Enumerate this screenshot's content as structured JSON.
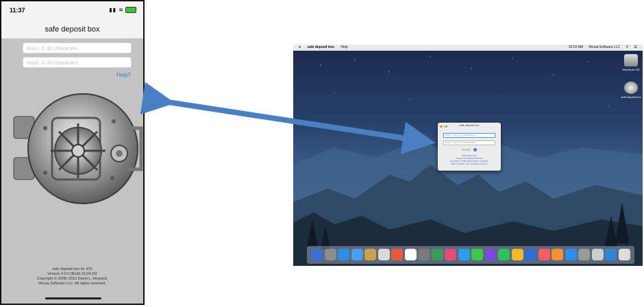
{
  "phone": {
    "time": "11:37",
    "status_icons": "▮▮ ≋",
    "nav_title": "safe deposit box",
    "key1_placeholder": "Key1: 2–32 characters",
    "key2_placeholder": "Key2: 2–32 characters",
    "help_link": "Help?",
    "footer": [
      "safe deposit box for iOS",
      "Version 4.0.0 (Build 19.04.20)",
      "Copyright © 2008–2019 David L. Neyland,",
      "Woula Software LLC. All rights reserved."
    ]
  },
  "mac": {
    "menubar": {
      "apple": "",
      "app_menu": "safe deposit box",
      "help_menu": "Help",
      "time": "10:52 AM",
      "vendor": "Woula Software LLC"
    },
    "desktop_icons": [
      {
        "label": "Macintosh HD"
      },
      {
        "label": "safe deposit box"
      }
    ],
    "window": {
      "title": "safe deposit box",
      "key1_placeholder": "Key1: enter 2–32 characters",
      "key2_placeholder": "Key2: enter 2–32 characters",
      "action_label": "Encrypt",
      "info": [
        "safe deposit box",
        "Version 4.0.0 (Build 19.04.20)",
        "Copyright © 2008–2019 David L. Neyland,",
        "Woula Software LLC. All rights reserved."
      ]
    },
    "dock_colors": [
      "#3b6fd1",
      "#8c8c8c",
      "#2d8ee8",
      "#4aa0e8",
      "#c9a24a",
      "#d9d9d9",
      "#e85a3b",
      "#ffffff",
      "#7a7a7a",
      "#3a9b5a",
      "#e84b7a",
      "#2d9bf0",
      "#3cc94a",
      "#7c4ad9",
      "#2dbf58",
      "#f3b72c",
      "#2b6fd6",
      "#fa5a6a",
      "#ff8f2c",
      "#2d8ef0",
      "#999999",
      "#cccccc",
      "#2f86d8",
      "#dddddd"
    ]
  },
  "colors": {
    "arrow": "#4a7fc1",
    "accent": "#2a7bd9"
  }
}
